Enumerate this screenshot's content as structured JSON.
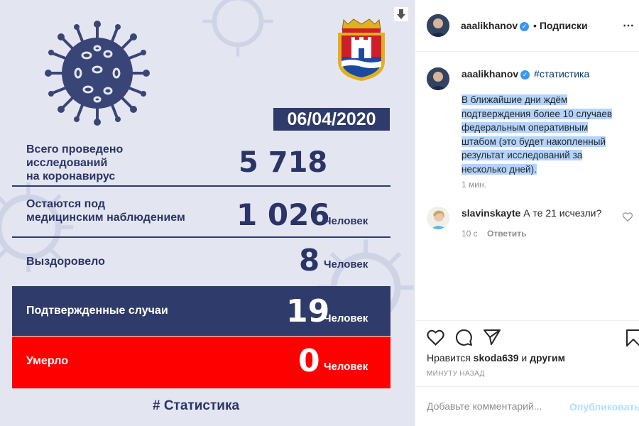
{
  "infographic": {
    "date": "06/04/2020",
    "stats": [
      {
        "label_lines": [
          "Всего проведено",
          "исследований",
          "на коронавирус"
        ],
        "value": "5 718",
        "unit": ""
      },
      {
        "label_lines": [
          "Остаются под",
          "медицинским наблюдением"
        ],
        "value": "1 026",
        "unit": "Человек"
      },
      {
        "label_lines": [
          "Выздоровело"
        ],
        "value": "8",
        "unit": "Человек"
      }
    ],
    "confirmed": {
      "label": "Подтвержденные случаи",
      "value": "19",
      "unit": "Человек",
      "color": "#2f3b6b"
    },
    "deaths": {
      "label": "Умерло",
      "value": "0",
      "unit": "Человек",
      "color": "#ff0000"
    },
    "hashtag": "# Статистика",
    "colors": {
      "navy": "#2f3b6b",
      "background": "#e3e6f0",
      "red": "#ff0000"
    },
    "icons": {
      "virus": "virus-icon",
      "coat_of_arms": "kaliningrad-coat-of-arms",
      "download": "download-icon"
    }
  },
  "sidebar": {
    "header": {
      "username": "aaalikhanov",
      "separator": "•",
      "follow_label": "Подписки",
      "more": "more-options-icon"
    },
    "caption": {
      "username": "aaalikhanov",
      "hashtag": "#статистика",
      "lines": [
        "В ближайшие дни ждём",
        "подтверждения более 10 случаев",
        "федеральным оперативным",
        "штабом (это будет накопленный",
        "результат исследований за",
        "несколько дней)."
      ],
      "time": "1 мин."
    },
    "comment": {
      "username": "slavinskayte",
      "text": "А те 21 исчезли?",
      "time": "10 с",
      "reply_label": "Ответить"
    },
    "actions": {
      "icons": [
        "heart-icon",
        "comment-icon",
        "share-icon",
        "bookmark-icon"
      ]
    },
    "likes": {
      "prefix": "Нравится",
      "user": "skoda639",
      "joiner": "и",
      "others": "другим"
    },
    "post_time": "МИНУТУ НАЗАД",
    "add_comment": {
      "placeholder": "Добавьте комментарий...",
      "publish_label": "Опубликовать",
      "publish_color": "#b2dffc"
    }
  }
}
